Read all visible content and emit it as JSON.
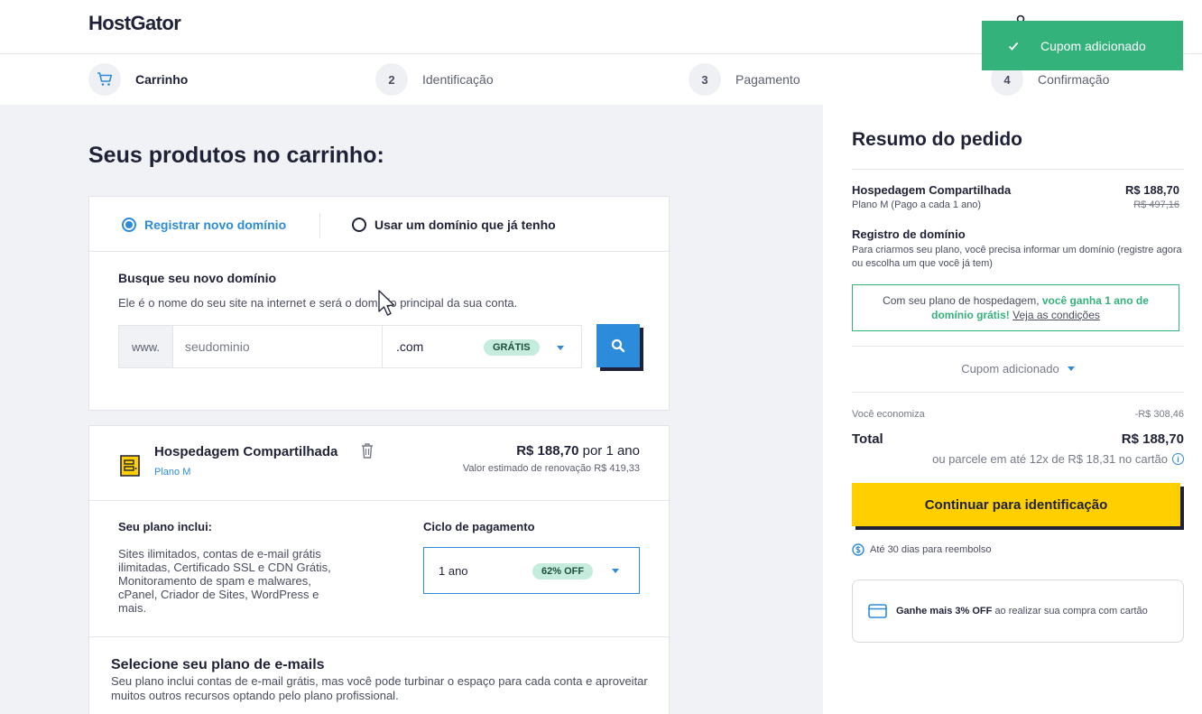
{
  "header": {
    "logo": "HostGator"
  },
  "toast": {
    "message": "Cupom adicionado"
  },
  "steps": [
    {
      "number": "",
      "label": "Carrinho"
    },
    {
      "number": "2",
      "label": "Identificação"
    },
    {
      "number": "3",
      "label": "Pagamento"
    },
    {
      "number": "4",
      "label": "Confirmação"
    }
  ],
  "cart": {
    "title": "Seus produtos no carrinho:",
    "domain": {
      "option_new": "Registrar novo domínio",
      "option_existing": "Usar um domínio que já tenho",
      "search_title": "Busque seu novo domínio",
      "search_desc": "Ele é o nome do seu site na internet e será o domínio principal da sua conta.",
      "prefix": "www.",
      "placeholder": "seudominio",
      "tld": ".com",
      "tld_badge": "GRÁTIS"
    },
    "product": {
      "name": "Hospedagem Compartilhada",
      "plan": "Plano M",
      "price": "R$ 188,70",
      "period": "por 1 ano",
      "renewal": "Valor estimado de renovação R$ 419,33",
      "includes_title": "Seu plano inclui:",
      "includes_text": "Sites ilimitados, contas de e-mail grátis ilimitadas, Certificado SSL e CDN Grátis, Monitoramento de spam e malwares, cPanel, Criador de Sites, WordPress e mais.",
      "cycle_title": "Ciclo de pagamento",
      "cycle_value": "1 ano",
      "cycle_badge": "62% OFF"
    },
    "email": {
      "title": "Selecione seu plano de e-mails",
      "desc": "Seu plano inclui contas de e-mail grátis, mas você pode turbinar o espaço para cada conta e aproveitar muitos outros recursos optando pelo plano profissional."
    }
  },
  "summary": {
    "title": "Resumo do pedido",
    "hosting_name": "Hospedagem Compartilhada",
    "hosting_plan": "Plano M (Pago a cada 1 ano)",
    "hosting_price": "R$ 188,70",
    "hosting_old_price": "R$ 497,16",
    "domain_title": "Registro de domínio",
    "domain_desc": "Para criarmos seu plano, você precisa informar um domínio (registre agora ou escolha um que você já tem)",
    "promo_text": "Com seu plano de hospedagem,",
    "promo_green": "você ganha 1 ano de domínio grátis!",
    "promo_link": "Veja as condições",
    "coupon_label": "Cupom adicionado",
    "savings_label": "Você economiza",
    "savings_value": "-R$ 308,46",
    "total_label": "Total",
    "total_value": "R$ 188,70",
    "installments": "ou parcele em até 12x de R$ 18,31 no cartão",
    "cta": "Continuar para identificação",
    "refund": "Até 30 dias para reembolso",
    "card_offer_bold": "Ganhe mais 3% OFF",
    "card_offer_text": "ao realizar sua compra com cartão"
  },
  "colors": {
    "accent_blue": "#2d8bdb",
    "success_green": "#34b27b",
    "cta_yellow": "#ffcf00",
    "dark": "#1f2137"
  }
}
